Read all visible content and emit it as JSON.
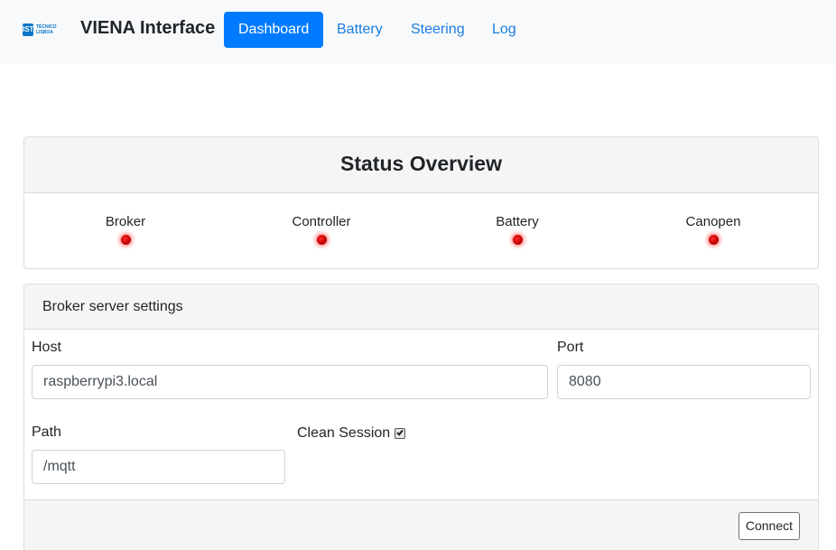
{
  "navbar": {
    "logo_mark": "IST",
    "logo_text_line1": "TÉCNICO",
    "logo_text_line2": "LISBOA",
    "title": "VIENA Interface",
    "links": [
      {
        "label": "Dashboard",
        "active": true
      },
      {
        "label": "Battery",
        "active": false
      },
      {
        "label": "Steering",
        "active": false
      },
      {
        "label": "Log",
        "active": false
      }
    ]
  },
  "status": {
    "title": "Status Overview",
    "items": [
      {
        "label": "Broker",
        "state": "disconnected",
        "color": "#d00000"
      },
      {
        "label": "Controller",
        "state": "disconnected",
        "color": "#d00000"
      },
      {
        "label": "Battery",
        "state": "disconnected",
        "color": "#d00000"
      },
      {
        "label": "Canopen",
        "state": "disconnected",
        "color": "#d00000"
      }
    ]
  },
  "broker": {
    "title": "Broker server settings",
    "host_label": "Host",
    "host_value": "raspberrypi3.local",
    "port_label": "Port",
    "port_value": "8080",
    "path_label": "Path",
    "path_value": "/mqtt",
    "clean_session_label": "Clean Session",
    "clean_session_checked": true,
    "connect_label": "Connect"
  },
  "colors": {
    "primary": "#007bff",
    "link": "#1a7de0",
    "navbar_bg": "#f8f9fa",
    "card_header_bg": "#f5f5f5",
    "status_off": "#d00000"
  }
}
